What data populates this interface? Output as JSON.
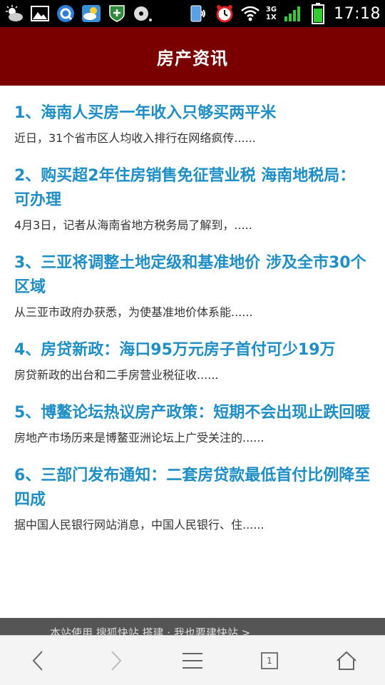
{
  "status_bar": {
    "time": "17:18",
    "net_top": "3G",
    "net_bottom": "1X",
    "icons": [
      "weather-icon",
      "gallery-icon",
      "browser-q-icon",
      "weather-cloud-icon",
      "shield-icon",
      "disc-icon",
      "screen-cast-icon",
      "alarm-icon",
      "wifi-icon",
      "signal-icon",
      "battery-icon"
    ]
  },
  "header": {
    "title": "房产资讯"
  },
  "news": [
    {
      "title": "1、海南人买房一年收入只够买两平米",
      "summary": "近日，31个省市区人均收入排行在网络疯传......"
    },
    {
      "title": "2、购买超2年住房销售免征营业税 海南地税局：可办理",
      "summary": "4月3日，记者从海南省地方税务局了解到，....."
    },
    {
      "title": "3、三亚将调整土地定级和基准地价 涉及全市30个区域",
      "summary": "从三亚市政府办获悉，为使基准地价体系能......"
    },
    {
      "title": "4、房贷新政：海口95万元房子首付可少19万",
      "summary": "房贷新政的出台和二手房营业税征收......"
    },
    {
      "title": "5、博鳌论坛热议房产政策：短期不会出现止跌回暖",
      "summary": "房地产市场历来是博鳌亚洲论坛上广受关注的......"
    },
    {
      "title": "6、三部门发布通知：二套房贷款最低首付比例降至四成",
      "summary": "据中国人民银行网站消息，中国人民银行、住......"
    }
  ],
  "footer": {
    "text": "本站使用 搜狐快站 搭建 · 我也要建快站 >"
  },
  "toolbar": {
    "tab_count": "1"
  },
  "colors": {
    "header_bg": "#7a0000",
    "title_link": "#1e8fc6",
    "summary_text": "#333333"
  }
}
